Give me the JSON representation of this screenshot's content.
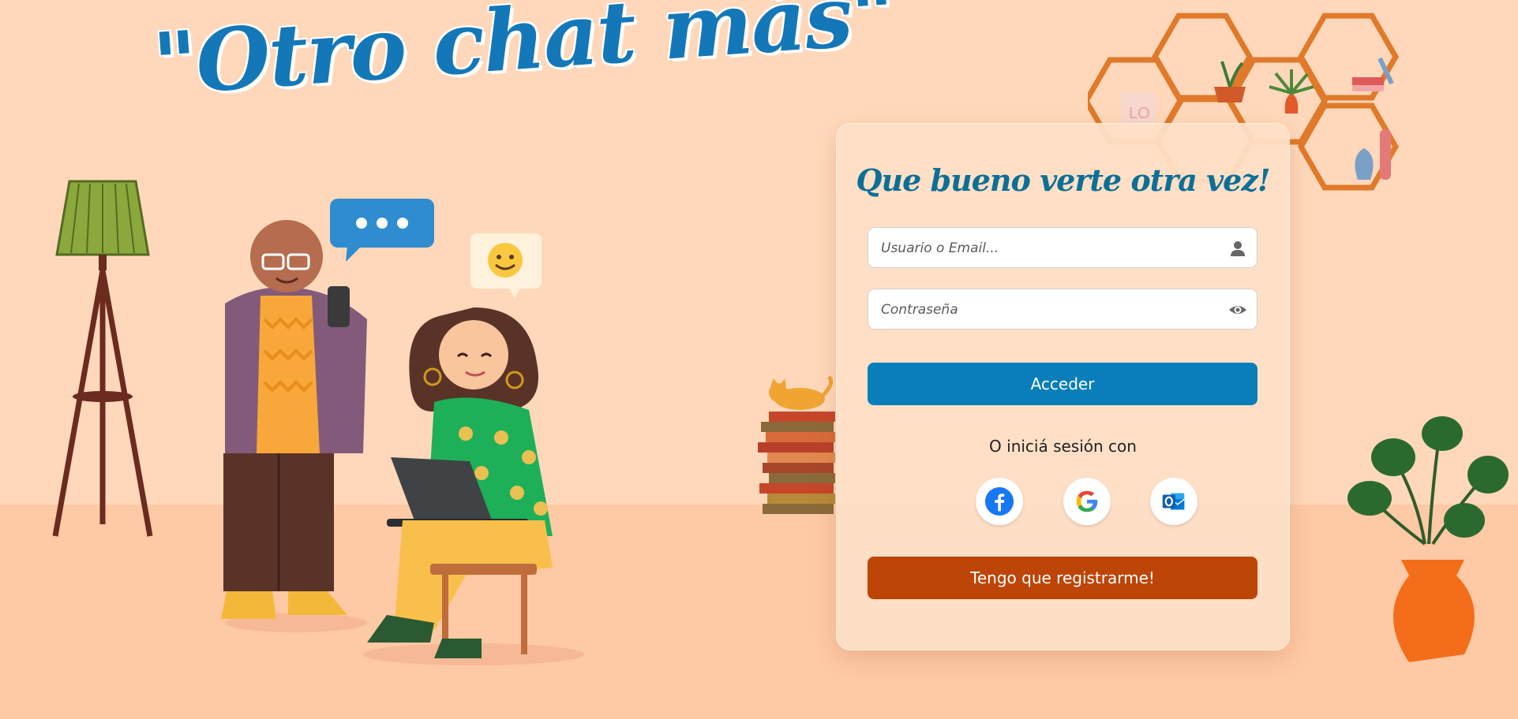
{
  "hero": {
    "title": "\"Otro chat más\""
  },
  "login": {
    "title": "Que bueno verte otra vez!",
    "username_placeholder": "Usuario o Email...",
    "password_placeholder": "Contraseña",
    "submit_label": "Acceder",
    "alt_login_text": "O iniciá sesión con",
    "social": [
      {
        "name": "Facebook",
        "icon": "facebook-icon"
      },
      {
        "name": "Google",
        "icon": "google-icon"
      },
      {
        "name": "Outlook",
        "icon": "outlook-icon"
      }
    ],
    "register_label": "Tengo que registrarme!"
  },
  "decor": {
    "tile_text": "LO"
  },
  "colors": {
    "background": "#ffd8bb",
    "accent_blue": "#0a7eba",
    "accent_orange": "#bd4507",
    "title_blue": "#1478b8"
  }
}
